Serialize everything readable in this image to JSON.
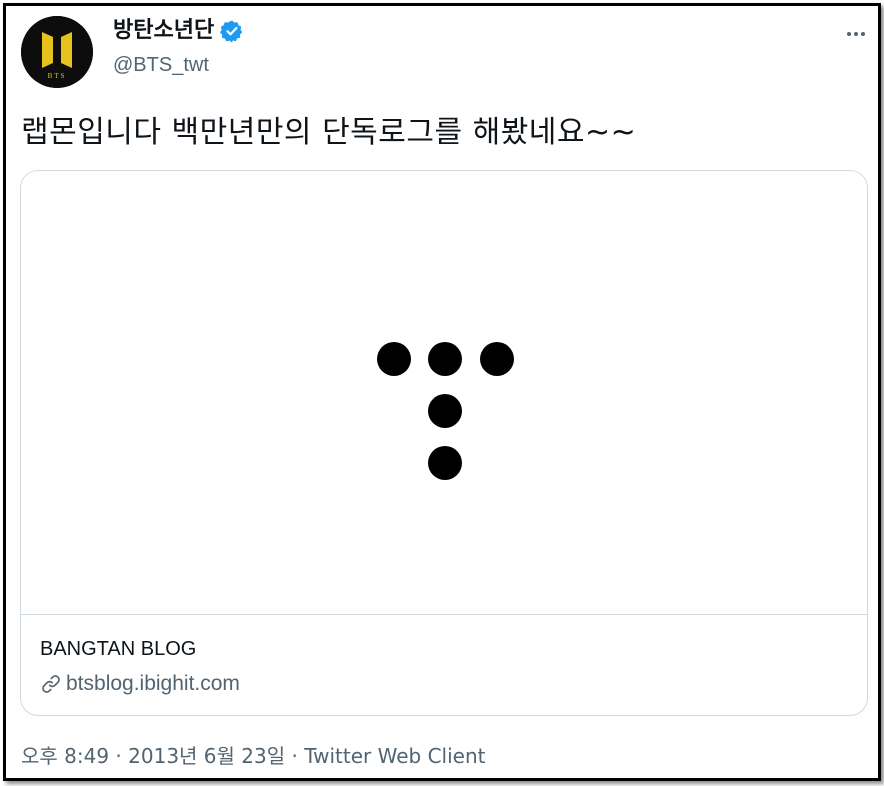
{
  "tweet": {
    "display_name": "방탄소년단",
    "handle": "@BTS_twt",
    "avatar_text": "BTS",
    "text": "랩몬입니다 백만년만의 단독로그를 해봤네요~~",
    "card": {
      "title": "BANGTAN BLOG",
      "domain": "btsblog.ibighit.com"
    },
    "meta": {
      "time": "오후 8:49",
      "separator1": " · ",
      "date": "2013년 6월 23일",
      "separator2": " · ",
      "source": "Twitter Web Client"
    }
  },
  "icons": {
    "verified": "verified-badge-icon",
    "more": "more-options-icon",
    "link": "link-icon"
  },
  "colors": {
    "text_primary": "#0f1419",
    "text_secondary": "#536471",
    "verified_blue": "#1d9bf0",
    "card_border": "#cfd9de",
    "avatar_bg": "#0d0d0d",
    "avatar_gold": "#e8c21c"
  }
}
